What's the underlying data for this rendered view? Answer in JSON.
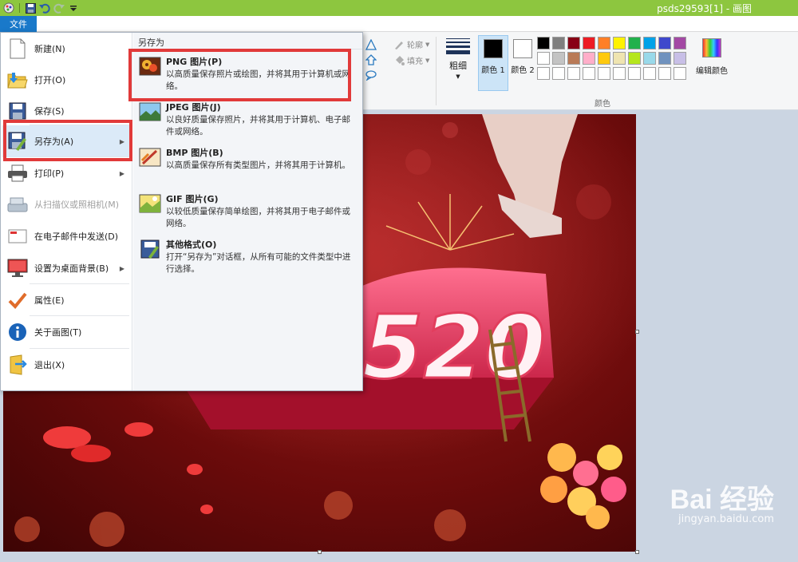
{
  "window": {
    "title": "psds29593[1] - 画图"
  },
  "ribbon": {
    "file_tab": "文件",
    "outline_label": "轮廓",
    "fill_label": "填充",
    "thickness_label": "粗细",
    "color1_label": "颜色 1",
    "color2_label": "颜色 2",
    "edit_colors_label": "编辑颜色",
    "colors_group_label": "颜色",
    "color1": "#000000",
    "color2": "#ffffff",
    "palette": [
      "#000000",
      "#7f7f7f",
      "#880015",
      "#ed1c24",
      "#ff7f27",
      "#fff200",
      "#22b14c",
      "#00a2e8",
      "#3f48cc",
      "#a349a4",
      "#ffffff",
      "#c3c3c3",
      "#b97a57",
      "#ffaec9",
      "#ffc90e",
      "#efe4b0",
      "#b5e61d",
      "#99d9ea",
      "#7092be",
      "#c8bfe7",
      "#ffffff",
      "#ffffff",
      "#ffffff",
      "#ffffff",
      "#ffffff",
      "#ffffff",
      "#ffffff",
      "#ffffff",
      "#ffffff",
      "#ffffff"
    ]
  },
  "file_menu": {
    "items": [
      {
        "label": "新建(N)",
        "icon": "new-file-icon",
        "submenu": false,
        "disabled": false
      },
      {
        "label": "打开(O)",
        "icon": "open-folder-icon",
        "submenu": false,
        "disabled": false
      },
      {
        "label": "保存(S)",
        "icon": "save-icon",
        "submenu": false,
        "disabled": false
      },
      {
        "label": "另存为(A)",
        "icon": "save-as-icon",
        "submenu": true,
        "disabled": false
      },
      {
        "label": "打印(P)",
        "icon": "printer-icon",
        "submenu": true,
        "disabled": false
      },
      {
        "label": "从扫描仪或照相机(M)",
        "icon": "scanner-icon",
        "submenu": false,
        "disabled": true
      },
      {
        "label": "在电子邮件中发送(D)",
        "icon": "email-icon",
        "submenu": false,
        "disabled": false
      },
      {
        "label": "设置为桌面背景(B)",
        "icon": "desktop-background-icon",
        "submenu": true,
        "disabled": false
      },
      {
        "label": "属性(E)",
        "icon": "checkmark-icon",
        "submenu": false,
        "disabled": false
      },
      {
        "label": "关于画图(T)",
        "icon": "info-icon",
        "submenu": false,
        "disabled": false
      },
      {
        "label": "退出(X)",
        "icon": "exit-icon",
        "submenu": false,
        "disabled": false
      }
    ],
    "save_as_panel": {
      "title": "另存为",
      "options": [
        {
          "title": "PNG 图片(P)",
          "desc": "以高质量保存照片或绘图，并将其用于计算机或网络。",
          "icon": "png-image-icon"
        },
        {
          "title": "JPEG 图片(J)",
          "desc": "以良好质量保存照片，并将其用于计算机、电子邮件或网络。",
          "icon": "jpeg-image-icon"
        },
        {
          "title": "BMP 图片(B)",
          "desc": "以高质量保存所有类型图片，并将其用于计算机。",
          "icon": "bmp-image-icon"
        },
        {
          "title": "GIF 图片(G)",
          "desc": "以较低质量保存简单绘图，并将其用于电子邮件或网络。",
          "icon": "gif-image-icon"
        },
        {
          "title": "其他格式(O)",
          "desc": "打开“另存为”对话框，从所有可能的文件类型中进行选择。",
          "icon": "other-formats-icon"
        }
      ]
    }
  },
  "canvas": {
    "image_text": "520",
    "watermark_main": "Bai 经验",
    "watermark_sub": "jingyan.baidu.com"
  }
}
